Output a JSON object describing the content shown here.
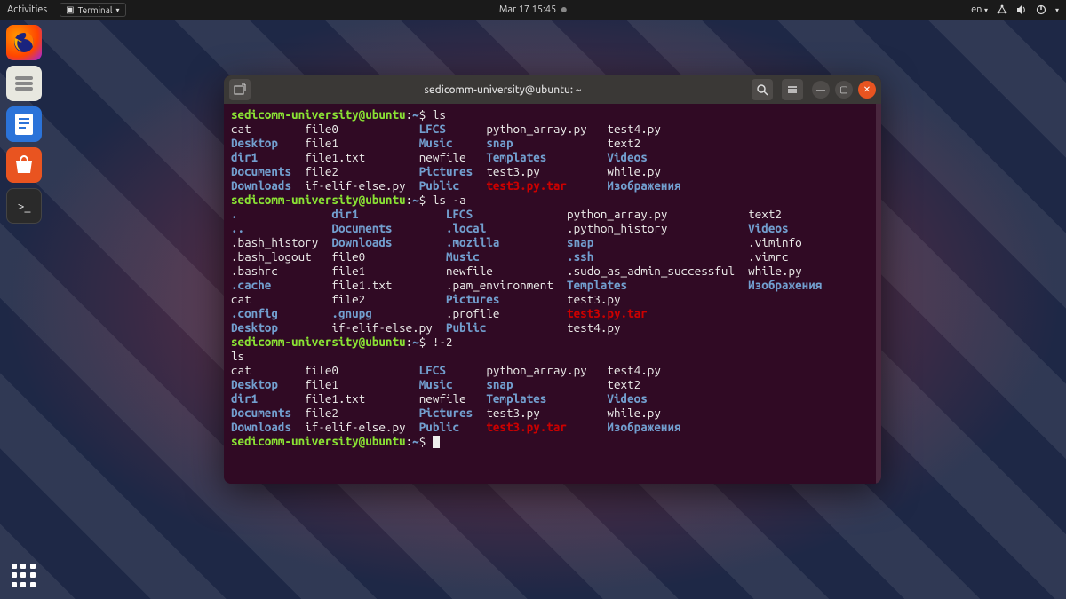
{
  "topbar": {
    "activities": "Activities",
    "terminal_dd": "Terminal",
    "datetime": "Mar 17  15:45",
    "lang": "en"
  },
  "dock": {
    "items": [
      "firefox",
      "files",
      "libreoffice-writer",
      "software",
      "terminal"
    ]
  },
  "window": {
    "title": "sedicomm-university@ubuntu: ~"
  },
  "terminal": {
    "prompt_user": "sedicomm-university@ubuntu",
    "prompt_path": "~",
    "prompt_sym": "$",
    "cmd1": "ls",
    "cmd2": "ls -a",
    "cmd3": "!-2",
    "echo3": "ls",
    "ls_cols": [
      [
        {
          "t": "cat",
          "c": "w"
        },
        {
          "t": "Desktop",
          "c": "b"
        },
        {
          "t": "dir1",
          "c": "b"
        },
        {
          "t": "Documents",
          "c": "b"
        },
        {
          "t": "Downloads",
          "c": "b"
        }
      ],
      [
        {
          "t": "file0",
          "c": "w"
        },
        {
          "t": "file1",
          "c": "w"
        },
        {
          "t": "file1.txt",
          "c": "w"
        },
        {
          "t": "file2",
          "c": "w"
        },
        {
          "t": "if-elif-else.py",
          "c": "w"
        }
      ],
      [
        {
          "t": "LFCS",
          "c": "b"
        },
        {
          "t": "Music",
          "c": "b"
        },
        {
          "t": "newfile",
          "c": "w"
        },
        {
          "t": "Pictures",
          "c": "b"
        },
        {
          "t": "Public",
          "c": "b"
        }
      ],
      [
        {
          "t": "python_array.py",
          "c": "w"
        },
        {
          "t": "snap",
          "c": "b"
        },
        {
          "t": "Templates",
          "c": "b"
        },
        {
          "t": "test3.py",
          "c": "w"
        },
        {
          "t": "test3.py.tar",
          "c": "r"
        }
      ],
      [
        {
          "t": "test4.py",
          "c": "w"
        },
        {
          "t": "text2",
          "c": "w"
        },
        {
          "t": "Videos",
          "c": "b"
        },
        {
          "t": "while.py",
          "c": "w"
        },
        {
          "t": "Изображения",
          "c": "b"
        }
      ]
    ],
    "ls_widths": [
      11,
      17,
      10,
      18,
      0
    ],
    "lsa_cols": [
      [
        {
          "t": ".",
          "c": "b"
        },
        {
          "t": "..",
          "c": "b"
        },
        {
          "t": ".bash_history",
          "c": "w"
        },
        {
          "t": ".bash_logout",
          "c": "w"
        },
        {
          "t": ".bashrc",
          "c": "w"
        },
        {
          "t": ".cache",
          "c": "b"
        },
        {
          "t": "cat",
          "c": "w"
        },
        {
          "t": ".config",
          "c": "b"
        },
        {
          "t": "Desktop",
          "c": "b"
        }
      ],
      [
        {
          "t": "dir1",
          "c": "b"
        },
        {
          "t": "Documents",
          "c": "b"
        },
        {
          "t": "Downloads",
          "c": "b"
        },
        {
          "t": "file0",
          "c": "w"
        },
        {
          "t": "file1",
          "c": "w"
        },
        {
          "t": "file1.txt",
          "c": "w"
        },
        {
          "t": "file2",
          "c": "w"
        },
        {
          "t": ".gnupg",
          "c": "b"
        },
        {
          "t": "if-elif-else.py",
          "c": "w"
        }
      ],
      [
        {
          "t": "LFCS",
          "c": "b"
        },
        {
          "t": ".local",
          "c": "b"
        },
        {
          "t": ".mozilla",
          "c": "b"
        },
        {
          "t": "Music",
          "c": "b"
        },
        {
          "t": "newfile",
          "c": "w"
        },
        {
          "t": ".pam_environment",
          "c": "w"
        },
        {
          "t": "Pictures",
          "c": "b"
        },
        {
          "t": ".profile",
          "c": "w"
        },
        {
          "t": "Public",
          "c": "b"
        }
      ],
      [
        {
          "t": "python_array.py",
          "c": "w"
        },
        {
          "t": ".python_history",
          "c": "w"
        },
        {
          "t": "snap",
          "c": "b"
        },
        {
          "t": ".ssh",
          "c": "b"
        },
        {
          "t": ".sudo_as_admin_successful",
          "c": "w"
        },
        {
          "t": "Templates",
          "c": "b"
        },
        {
          "t": "test3.py",
          "c": "w"
        },
        {
          "t": "test3.py.tar",
          "c": "r"
        },
        {
          "t": "test4.py",
          "c": "w"
        }
      ],
      [
        {
          "t": "text2",
          "c": "w"
        },
        {
          "t": "Videos",
          "c": "b"
        },
        {
          "t": ".viminfo",
          "c": "w"
        },
        {
          "t": ".vimrc",
          "c": "w"
        },
        {
          "t": "while.py",
          "c": "w"
        },
        {
          "t": "Изображения",
          "c": "b"
        },
        {
          "t": "",
          "c": "w"
        },
        {
          "t": "",
          "c": "w"
        },
        {
          "t": "",
          "c": "w"
        }
      ]
    ],
    "lsa_widths": [
      15,
      17,
      18,
      27,
      0
    ]
  }
}
